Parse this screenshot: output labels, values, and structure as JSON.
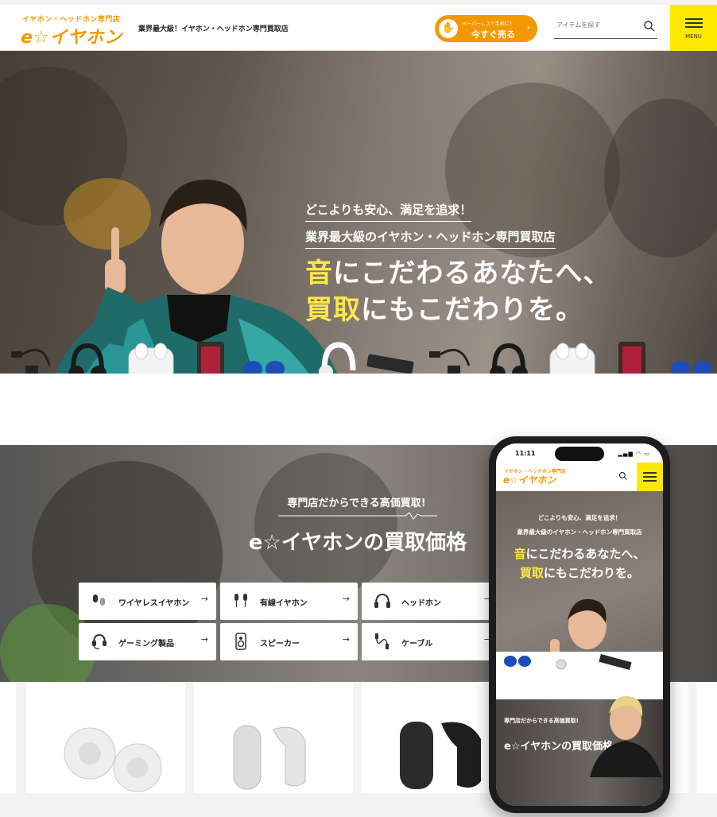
{
  "header": {
    "logo_top": "イヤホン・ヘッドホン専門店",
    "logo_main": "e☆イヤホン",
    "tagline": "業界最大級！イヤホン・ヘッドホン専門買取店",
    "sell_button": {
      "sub": "ペーパーレスで手軽に！",
      "label": "今すぐ売る",
      "icon": "hand-coin-icon"
    },
    "search": {
      "placeholder": "アイテムを探す",
      "icon": "search-icon"
    },
    "menu": {
      "label": "MENU",
      "icon": "hamburger-icon"
    }
  },
  "hero": {
    "sub1": "どこよりも安心、満足を追求！",
    "sub2": "業界最大級のイヤホン・ヘッドホン専門買取店",
    "line1_hl": "音",
    "line1_rest": "にこだわるあなたへ、",
    "line2_hl": "買取",
    "line2_rest": "にもこだわりを。"
  },
  "buy_section": {
    "kicker": "専門店だからできる高価買取!",
    "title": "e☆イヤホンの買取価格",
    "categories": [
      {
        "label": "ワイヤレスイヤホン",
        "icon": "wireless-earbuds-icon"
      },
      {
        "label": "有線イヤホン",
        "icon": "wired-earphones-icon"
      },
      {
        "label": "ヘッドホン",
        "icon": "headphones-icon"
      },
      {
        "label": "ゲーミング製品",
        "icon": "gaming-headset-icon"
      },
      {
        "label": "スピーカー",
        "icon": "speaker-icon"
      },
      {
        "label": "ケーブル",
        "icon": "cable-icon"
      }
    ],
    "arrow": "→"
  },
  "phone": {
    "time": "11:11",
    "logo_top": "イヤホン・ヘッドホン専門店",
    "logo_main": "e☆イヤホン",
    "sub1": "どこよりも安心、満足を追求！",
    "sub2": "業界最大級のイヤホン・ヘッドホン専門買取店",
    "line1_hl": "音",
    "line1_rest": "にこだわるあなたへ、",
    "line2_hl": "買取",
    "line2_rest": "にもこだわりを。",
    "buy_kicker": "専門店だからできる高価買取!",
    "buy_title": "e☆イヤホンの買取価格"
  },
  "colors": {
    "accent": "#f39800",
    "highlight": "#fde84a",
    "menu_bg": "#fde800"
  }
}
